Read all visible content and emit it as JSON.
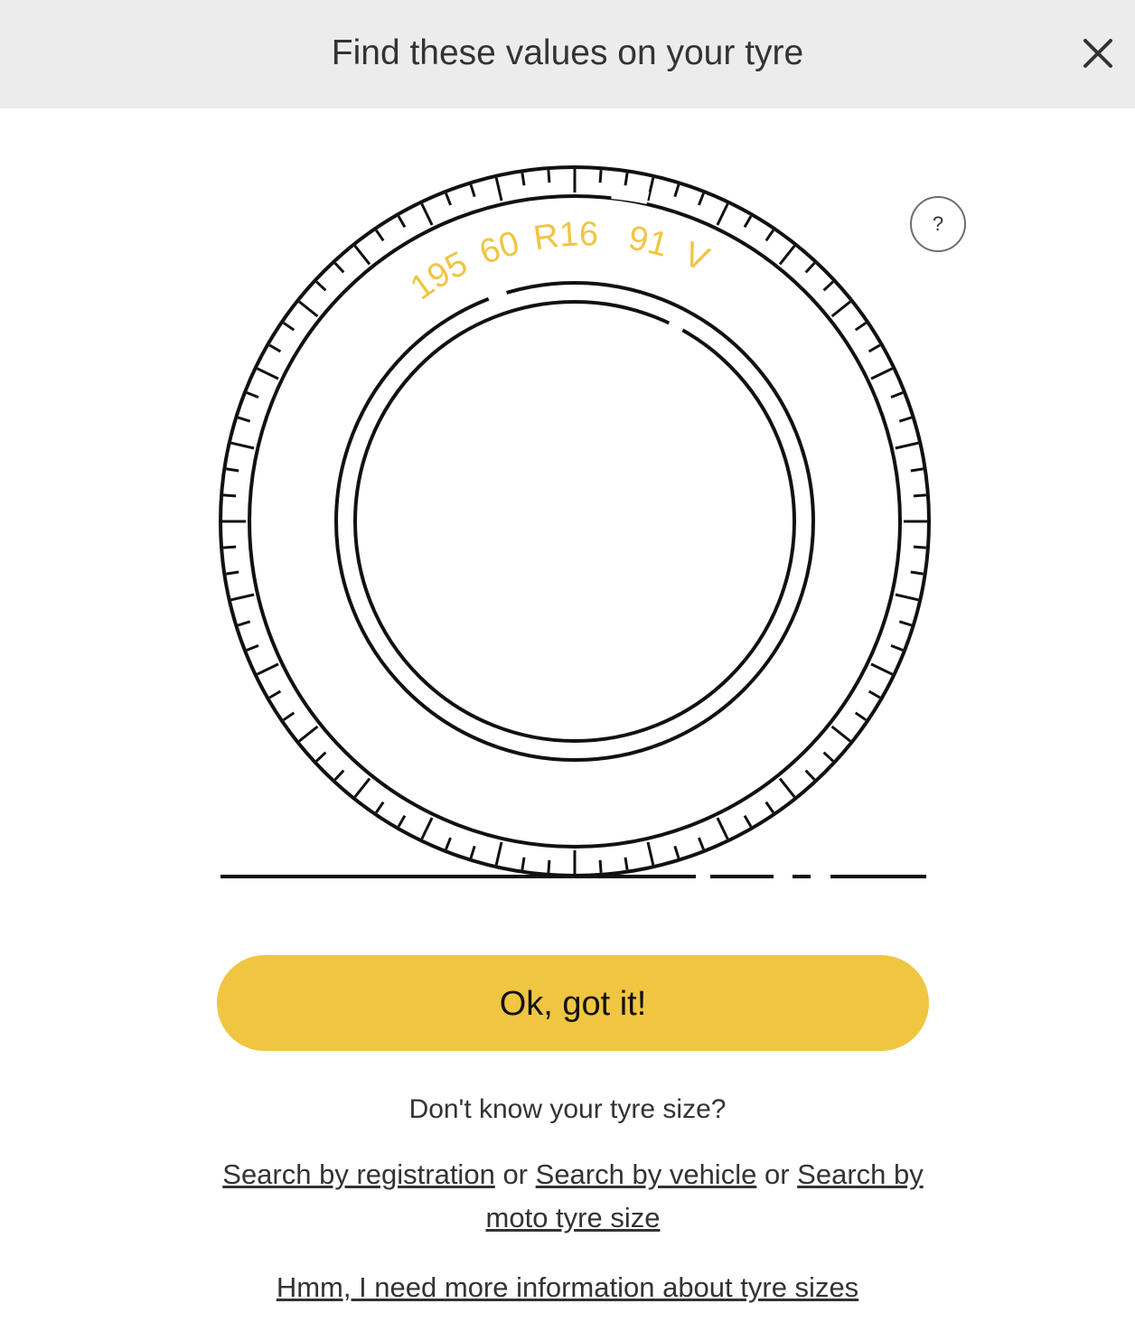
{
  "header": {
    "title": "Find these values on your tyre",
    "close_icon": "close-icon"
  },
  "help": {
    "label": "?"
  },
  "tyre_diagram": {
    "width_value": "195",
    "aspect_ratio_value": "60",
    "rim_value": "R16",
    "load_index_value": "91",
    "speed_rating_value": "V",
    "highlight_color": "#f0c541",
    "line_color": "#111111"
  },
  "ok_button": {
    "label": "Ok, got it!",
    "color": "#f0c541"
  },
  "help_text": {
    "question": "Don't know your tyre size?",
    "link_registration": "Search by registration",
    "or_1": "or",
    "link_vehicle": "Search by vehicle",
    "or_2": "or",
    "link_moto": "Search by moto tyre size",
    "more_info": "Hmm, I need more information about tyre sizes"
  }
}
